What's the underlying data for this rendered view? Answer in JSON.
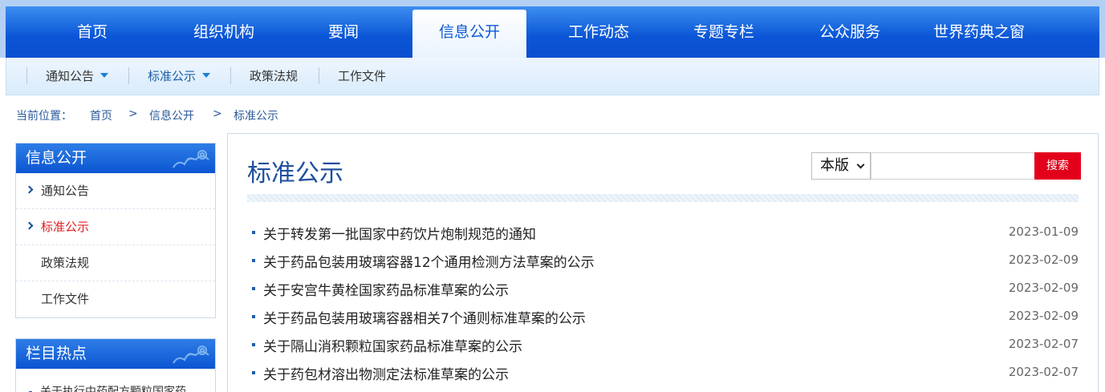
{
  "topnav": {
    "items": [
      {
        "label": "首页"
      },
      {
        "label": "组织机构"
      },
      {
        "label": "要闻"
      },
      {
        "label": "信息公开"
      },
      {
        "label": "工作动态"
      },
      {
        "label": "专题专栏"
      },
      {
        "label": "公众服务"
      },
      {
        "label": "世界药典之窗"
      }
    ],
    "active": "信息公开"
  },
  "subnav": {
    "items": [
      {
        "label": "通知公告"
      },
      {
        "label": "标准公示"
      },
      {
        "label": "政策法规"
      },
      {
        "label": "工作文件"
      }
    ]
  },
  "breadcrumb": {
    "prefix": "当前位置：",
    "items": [
      "首页",
      "信息公开",
      "标准公示"
    ],
    "separator": ">"
  },
  "sidebar": {
    "title": "信息公开",
    "items": [
      {
        "label": "通知公告"
      },
      {
        "label": "标准公示"
      },
      {
        "label": "政策法规"
      },
      {
        "label": "工作文件"
      }
    ],
    "hot_title": "栏目热点",
    "hot_items": [
      {
        "label": "关于执行中药配方颗粒国家药"
      }
    ]
  },
  "main": {
    "title": "标准公示",
    "search": {
      "scope": "本版",
      "placeholder": "",
      "button": "搜索"
    },
    "news": [
      {
        "title": "关于转发第一批国家中药饮片炮制规范的通知",
        "date": "2023-01-09"
      },
      {
        "title": "关于药品包装用玻璃容器12个通用检测方法草案的公示",
        "date": "2023-02-09"
      },
      {
        "title": "关于安宫牛黄栓国家药品标准草案的公示",
        "date": "2023-02-09"
      },
      {
        "title": "关于药品包装用玻璃容器相关7个通则标准草案的公示",
        "date": "2023-02-09"
      },
      {
        "title": "关于隔山消积颗粒国家药品标准草案的公示",
        "date": "2023-02-07"
      },
      {
        "title": "关于药包材溶出物测定法标准草案的公示",
        "date": "2023-02-07"
      }
    ]
  },
  "colors": {
    "nav_blue": "#0a55d6",
    "title_blue": "#1e4f9e",
    "search_red": "#e3001b",
    "active_red": "#dd2222"
  }
}
